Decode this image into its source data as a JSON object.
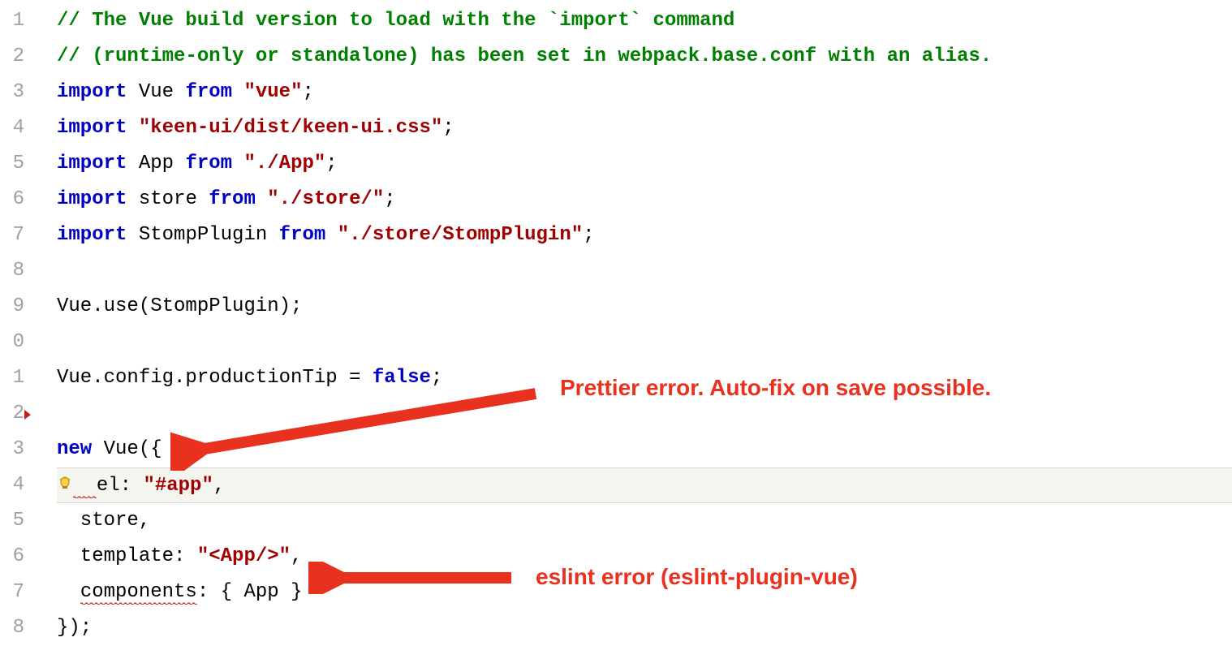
{
  "lines": {
    "1": {
      "comment": "// The Vue build version to load with the `import` command"
    },
    "2": {
      "comment": "// (runtime-only or standalone) has been set in webpack.base.conf with an alias."
    },
    "3": {
      "kw": "import",
      "id": "Vue",
      "from_kw": "from",
      "str": "\"vue\"",
      "semi": ";"
    },
    "4": {
      "kw": "import",
      "str": "\"keen-ui/dist/keen-ui.css\"",
      "semi": ";"
    },
    "5": {
      "kw": "import",
      "id": "App",
      "from_kw": "from",
      "str": "\"./App\"",
      "semi": ";"
    },
    "6": {
      "kw": "import",
      "id": "store",
      "from_kw": "from",
      "str": "\"./store/\"",
      "semi": ";"
    },
    "7": {
      "kw": "import",
      "id": "StompPlugin",
      "from_kw": "from",
      "str": "\"./store/StompPlugin\"",
      "semi": ";"
    },
    "9": {
      "text": "Vue.use(StompPlugin);"
    },
    "11": {
      "lhs": "Vue.config.productionTip = ",
      "val": "false",
      "semi": ";"
    },
    "13": {
      "kw": "new",
      "rest": " Vue({"
    },
    "14": {
      "pre": "  ",
      "key": "el:",
      "sp": " ",
      "str": "\"#app\"",
      "comma": ","
    },
    "15": {
      "text": "  store,"
    },
    "16": {
      "pre": "  template: ",
      "str": "\"<App/>\"",
      "comma": ","
    },
    "17": {
      "pre": "  ",
      "key": "components",
      "rest": ": { App }"
    },
    "18": {
      "text": "});"
    }
  },
  "line_numbers": [
    "1",
    "2",
    "3",
    "4",
    "5",
    "6",
    "7",
    "8",
    "9",
    "0",
    "1",
    "2",
    "3",
    "4",
    "5",
    "6",
    "7",
    "8"
  ],
  "annotations": {
    "prettier": "Prettier error. Auto-fix on save possible.",
    "eslint": "eslint error (eslint-plugin-vue)"
  }
}
